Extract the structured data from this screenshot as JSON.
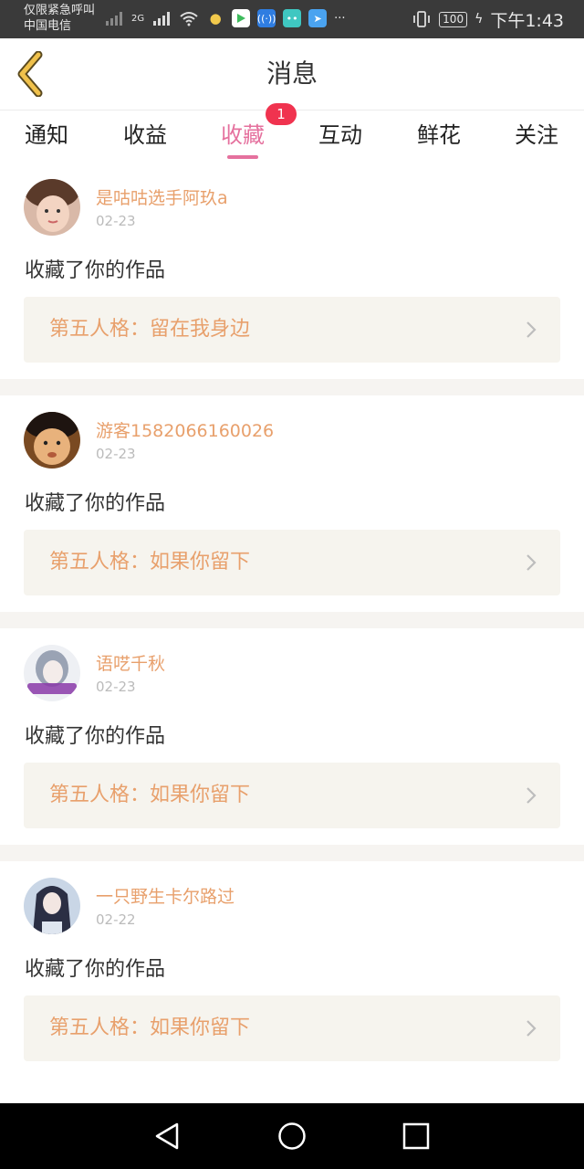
{
  "status_bar": {
    "emergency_text": "仅限紧急呼叫",
    "carrier": "中国电信",
    "network": "2G",
    "battery": "100",
    "time": "下午1:43",
    "overflow": "···"
  },
  "header": {
    "title": "消息"
  },
  "tabs": [
    {
      "label": "通知"
    },
    {
      "label": "收益"
    },
    {
      "label": "收藏",
      "badge": "1",
      "active": true
    },
    {
      "label": "互动"
    },
    {
      "label": "鲜花"
    },
    {
      "label": "关注"
    }
  ],
  "messages": [
    {
      "user": "是咕咕选手阿玖a",
      "date": "02-23",
      "action": "收藏了你的作品",
      "work": "第五人格：留在我身边"
    },
    {
      "user": "游客1582066160026",
      "date": "02-23",
      "action": "收藏了你的作品",
      "work": "第五人格：如果你留下"
    },
    {
      "user": "语呓千秋",
      "date": "02-23",
      "action": "收藏了你的作品",
      "work": "第五人格：如果你留下"
    },
    {
      "user": "一只野生卡尔路过",
      "date": "02-22",
      "action": "收藏了你的作品",
      "work": "第五人格：如果你留下"
    }
  ],
  "colors": {
    "accent": "#e5719e",
    "username": "#e8a06c",
    "badge": "#f0334f"
  },
  "icons": [
    "back-arrow-icon",
    "chevron-right-icon",
    "nav-back-icon",
    "nav-home-icon",
    "nav-recents-icon"
  ]
}
